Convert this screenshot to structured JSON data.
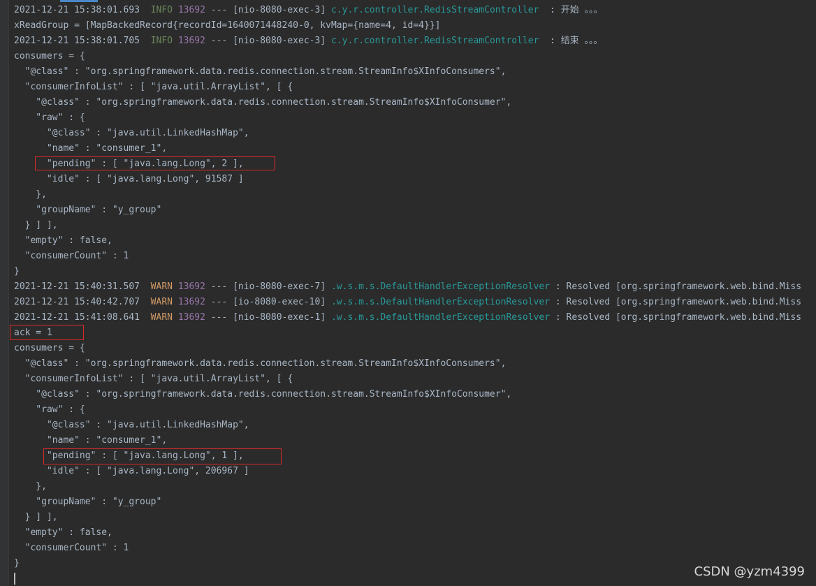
{
  "log": {
    "entries": [
      {
        "ts": "2021-12-21 15:38:01.693",
        "level": "INFO",
        "pid": "13692",
        "thread": "--- [nio-8080-exec-3]",
        "logger": "c.y.r.controller.RedisStreamController",
        "msg": "  : 开始 。。。"
      },
      {
        "text": "xReadGroup = [MapBackedRecord{recordId=1640071448240-0, kvMap={name=4, id=4}}]"
      },
      {
        "ts": "2021-12-21 15:38:01.705",
        "level": "INFO",
        "pid": "13692",
        "thread": "--- [nio-8080-exec-3]",
        "logger": "c.y.r.controller.RedisStreamController",
        "msg": "  : 结束 。。。"
      },
      {
        "text": "consumers = {"
      },
      {
        "text": "  \"@class\" : \"org.springframework.data.redis.connection.stream.StreamInfo$XInfoConsumers\","
      },
      {
        "text": "  \"consumerInfoList\" : [ \"java.util.ArrayList\", [ {"
      },
      {
        "text": "    \"@class\" : \"org.springframework.data.redis.connection.stream.StreamInfo$XInfoConsumer\","
      },
      {
        "text": "    \"raw\" : {"
      },
      {
        "text": "      \"@class\" : \"java.util.LinkedHashMap\","
      },
      {
        "text": "      \"name\" : \"consumer_1\","
      },
      {
        "text": "      \"pending\" : [ \"java.lang.Long\", 2 ],"
      },
      {
        "text": "      \"idle\" : [ \"java.lang.Long\", 91587 ]"
      },
      {
        "text": "    },"
      },
      {
        "text": "    \"groupName\" : \"y_group\""
      },
      {
        "text": "  } ] ],"
      },
      {
        "text": "  \"empty\" : false,"
      },
      {
        "text": "  \"consumerCount\" : 1"
      },
      {
        "text": "}"
      },
      {
        "ts": "2021-12-21 15:40:31.507",
        "level": "WARN",
        "pid": "13692",
        "thread": "--- [nio-8080-exec-7]",
        "logger": ".w.s.m.s.DefaultHandlerExceptionResolver",
        "msg": " : Resolved [org.springframework.web.bind.Miss"
      },
      {
        "ts": "2021-12-21 15:40:42.707",
        "level": "WARN",
        "pid": "13692",
        "thread": "--- [io-8080-exec-10]",
        "logger": ".w.s.m.s.DefaultHandlerExceptionResolver",
        "msg": " : Resolved [org.springframework.web.bind.Miss"
      },
      {
        "ts": "2021-12-21 15:41:08.641",
        "level": "WARN",
        "pid": "13692",
        "thread": "--- [nio-8080-exec-1]",
        "logger": ".w.s.m.s.DefaultHandlerExceptionResolver",
        "msg": " : Resolved [org.springframework.web.bind.Miss"
      },
      {
        "text": "ack = 1"
      },
      {
        "text": "consumers = {"
      },
      {
        "text": "  \"@class\" : \"org.springframework.data.redis.connection.stream.StreamInfo$XInfoConsumers\","
      },
      {
        "text": "  \"consumerInfoList\" : [ \"java.util.ArrayList\", [ {"
      },
      {
        "text": "    \"@class\" : \"org.springframework.data.redis.connection.stream.StreamInfo$XInfoConsumer\","
      },
      {
        "text": "    \"raw\" : {"
      },
      {
        "text": "      \"@class\" : \"java.util.LinkedHashMap\","
      },
      {
        "text": "      \"name\" : \"consumer_1\","
      },
      {
        "text": "      \"pending\" : [ \"java.lang.Long\", 1 ],"
      },
      {
        "text": "      \"idle\" : [ \"java.lang.Long\", 206967 ]"
      },
      {
        "text": "    },"
      },
      {
        "text": "    \"groupName\" : \"y_group\""
      },
      {
        "text": "  } ] ],"
      },
      {
        "text": "  \"empty\" : false,"
      },
      {
        "text": "  \"consumerCount\" : 1"
      },
      {
        "text": "}"
      }
    ]
  },
  "colors": {
    "background": "#2b2b2b",
    "text": "#a9b7c6",
    "info": "#6a8759",
    "warn": "#d19a66",
    "pid": "#9876aa",
    "logger": "#299999",
    "highlight_box": "#d92a2a"
  },
  "watermark": "CSDN @yzm4399"
}
